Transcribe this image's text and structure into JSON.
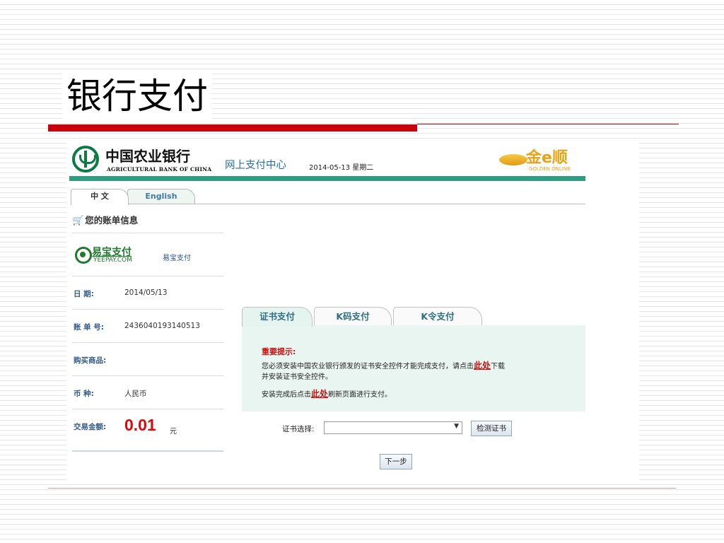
{
  "slide": {
    "title": "银行支付"
  },
  "header": {
    "bank_name_cn": "中国农业银行",
    "bank_name_en": "AGRICULTURAL BANK OF CHINA",
    "center_name": "网上支付中心",
    "date": "2014-05-13 星期二",
    "partner_logo_cn": "金e顺",
    "partner_logo_en": "GOLDEN ONLINE"
  },
  "lang_tabs": [
    {
      "label": "中 文",
      "active": true
    },
    {
      "label": "English",
      "active": false
    }
  ],
  "sidebar": {
    "title": "您的账单信息",
    "merchant_logo_cn": "易宝支付",
    "merchant_logo_en": "YEEPAY.COM",
    "merchant_name": "易宝支付",
    "rows": [
      {
        "label": "日 期:",
        "value": "2014/05/13"
      },
      {
        "label": "账 单 号:",
        "value": "2436040193140513"
      },
      {
        "label": "购买商品:",
        "value": ""
      },
      {
        "label": "币 种:",
        "value": "人民币"
      }
    ],
    "amount_label": "交易金额:",
    "amount_value": "0.01",
    "amount_unit": "元"
  },
  "pay_tabs": [
    {
      "label": "证书支付",
      "active": true
    },
    {
      "label": "K码支付",
      "active": false
    },
    {
      "label": "K令支付",
      "active": false
    }
  ],
  "notice": {
    "title": "重要提示:",
    "line1_pre": "您必须安装中国农业银行颁发的证书安全控件才能完成支付，请点击",
    "link1": "此处",
    "line1_post": "下载",
    "line2": "并安装证书安全控件。",
    "line3_pre": "安装完成后点击",
    "link2": "此处",
    "line3_post": "刷新页面进行支付。"
  },
  "cert": {
    "label": "证书选择:",
    "selected": "",
    "check_button": "检测证书"
  },
  "next_button": "下一步",
  "icons": {
    "bank_logo": "abc-bank-logo-icon",
    "cart": "shopping-cart-icon",
    "dropdown": "chevron-down-icon"
  },
  "colors": {
    "title_rule": "#c8000b",
    "bank_green": "#0b7a43",
    "header_bar": "#2f9d82",
    "panel_bg": "#e9f5f1",
    "amount": "#d80a0a"
  }
}
